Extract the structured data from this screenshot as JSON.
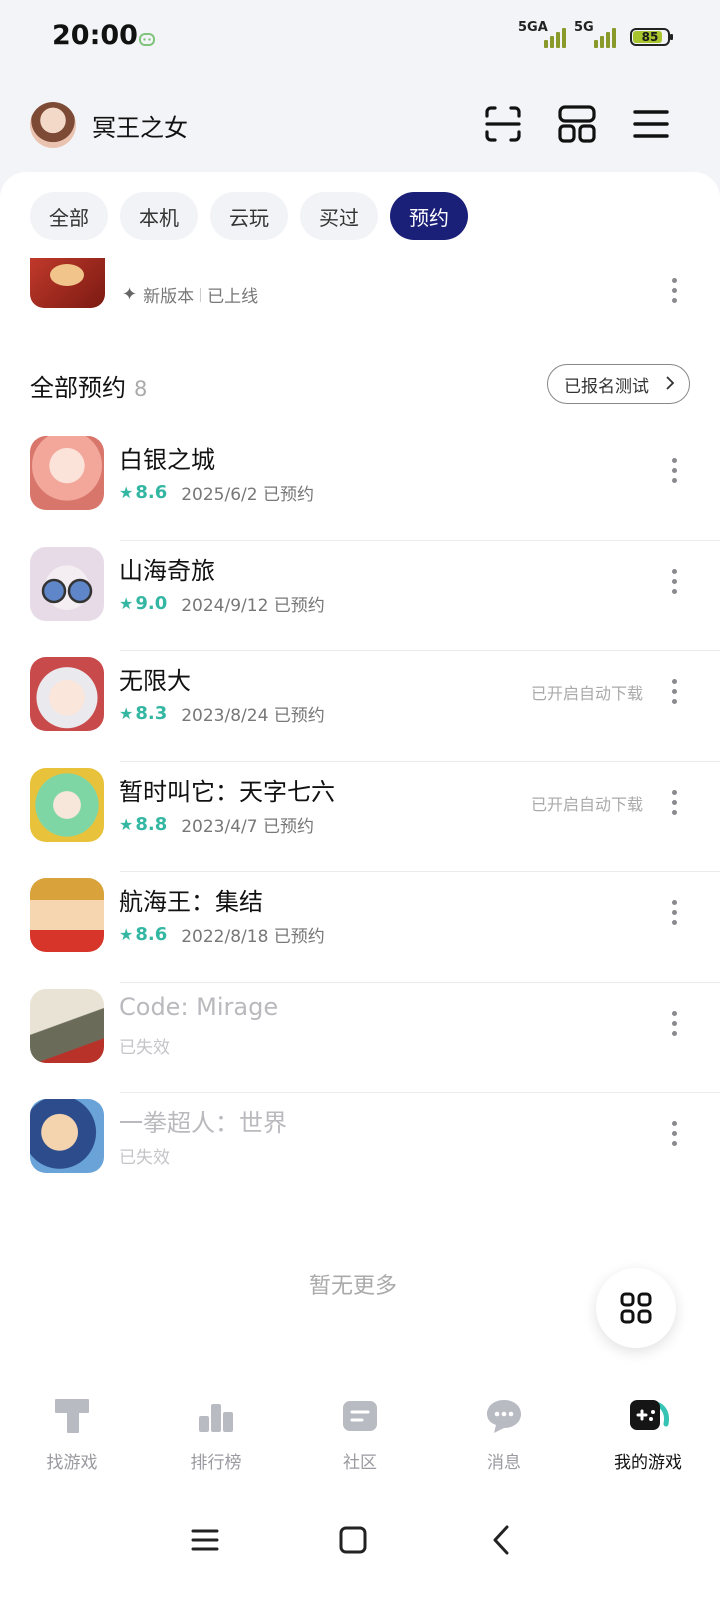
{
  "status": {
    "time": "20:00",
    "sim1": "5GA",
    "sim2": "5G",
    "battery": "85",
    "battery_level": 0.85
  },
  "header": {
    "username": "冥王之女"
  },
  "filters": [
    {
      "label": "全部"
    },
    {
      "label": "本机"
    },
    {
      "label": "云玩"
    },
    {
      "label": "买过"
    },
    {
      "label": "预约",
      "active": true
    }
  ],
  "partial_row": {
    "new_version": "新版本",
    "status": "已上线"
  },
  "section": {
    "title": "全部预约",
    "count": "8",
    "signup_button": "已报名测试"
  },
  "games": [
    {
      "title": "白银之城",
      "rating": "8.6",
      "date": "2025/6/2 已预约",
      "tag": "",
      "disabled": false
    },
    {
      "title": "山海奇旅",
      "rating": "9.0",
      "date": "2024/9/12 已预约",
      "tag": "",
      "disabled": false
    },
    {
      "title": "无限大",
      "rating": "8.3",
      "date": "2023/8/24 已预约",
      "tag": "已开启自动下载",
      "disabled": false
    },
    {
      "title": "暂时叫它：天字七六",
      "rating": "8.8",
      "date": "2023/4/7 已预约",
      "tag": "已开启自动下载",
      "disabled": false
    },
    {
      "title": "航海王：集结",
      "rating": "8.6",
      "date": "2022/8/18 已预约",
      "tag": "",
      "disabled": false
    },
    {
      "title": "Code: Mirage",
      "rating": "",
      "date": "已失效",
      "tag": "",
      "disabled": true
    },
    {
      "title": "一拳超人：世界",
      "rating": "",
      "date": "已失效",
      "tag": "",
      "disabled": true
    }
  ],
  "footer_text": "暂无更多",
  "bottom_nav": [
    {
      "label": "找游戏",
      "icon": "find-games-icon"
    },
    {
      "label": "排行榜",
      "icon": "ranking-icon"
    },
    {
      "label": "社区",
      "icon": "community-icon"
    },
    {
      "label": "消息",
      "icon": "message-icon"
    },
    {
      "label": "我的游戏",
      "icon": "my-games-icon",
      "active": true
    }
  ],
  "colors": {
    "accent": "#1a1f78",
    "rating": "#33b7a2"
  }
}
